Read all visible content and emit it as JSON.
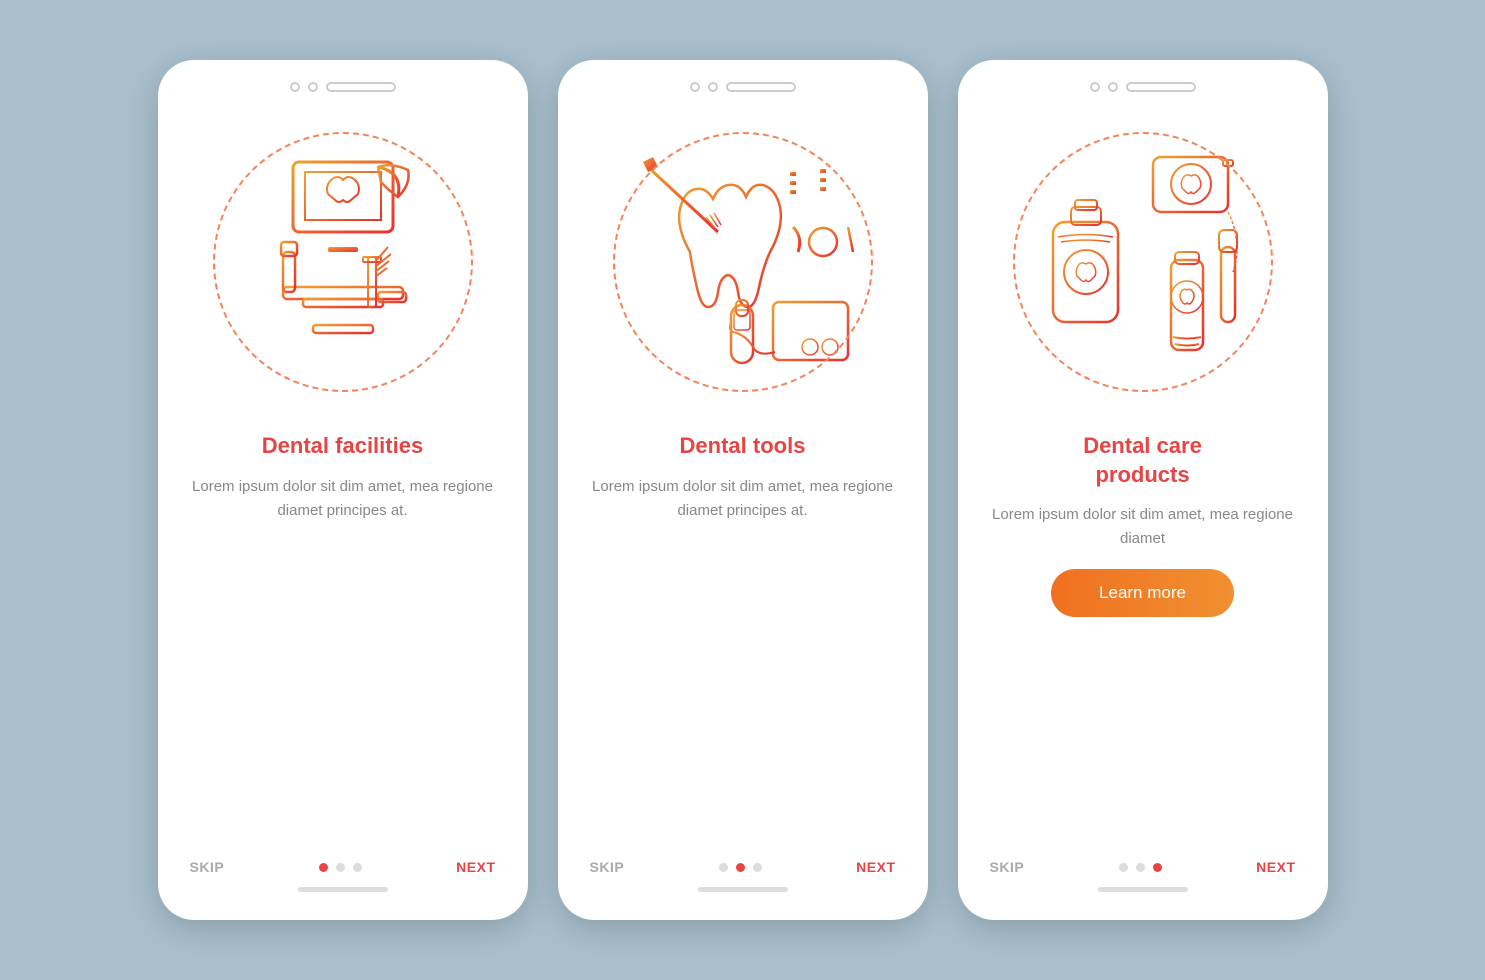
{
  "screens": [
    {
      "id": "dental-facilities",
      "top_dots": true,
      "title": "Dental facilities",
      "description": "Lorem ipsum dolor sit dim amet, mea regione diamet principes at.",
      "show_learn_more": false,
      "dots": [
        {
          "active": true
        },
        {
          "active": false
        },
        {
          "active": false
        }
      ],
      "skip_label": "SKIP",
      "next_label": "NEXT"
    },
    {
      "id": "dental-tools",
      "top_dots": true,
      "title": "Dental tools",
      "description": "Lorem ipsum dolor sit dim amet, mea regione diamet principes at.",
      "show_learn_more": false,
      "dots": [
        {
          "active": false
        },
        {
          "active": true
        },
        {
          "active": false
        }
      ],
      "skip_label": "SKIP",
      "next_label": "NEXT"
    },
    {
      "id": "dental-care-products",
      "top_dots": true,
      "title": "Dental care\nproducts",
      "description": "Lorem ipsum dolor sit dim amet, mea regione diamet",
      "show_learn_more": true,
      "learn_more_label": "Learn more",
      "dots": [
        {
          "active": false
        },
        {
          "active": false
        },
        {
          "active": true
        }
      ],
      "skip_label": "SKIP",
      "next_label": "NEXT"
    }
  ],
  "colors": {
    "accent_red": "#e84444",
    "accent_orange": "#f07020",
    "grad_start": "#f0a030",
    "grad_end": "#e83030",
    "dashed_circle": "#f4845a",
    "inactive_dot": "#dddddd",
    "text_gray": "#888888",
    "nav_gray": "#aaaaaa",
    "bg": "#a8bfcc"
  }
}
